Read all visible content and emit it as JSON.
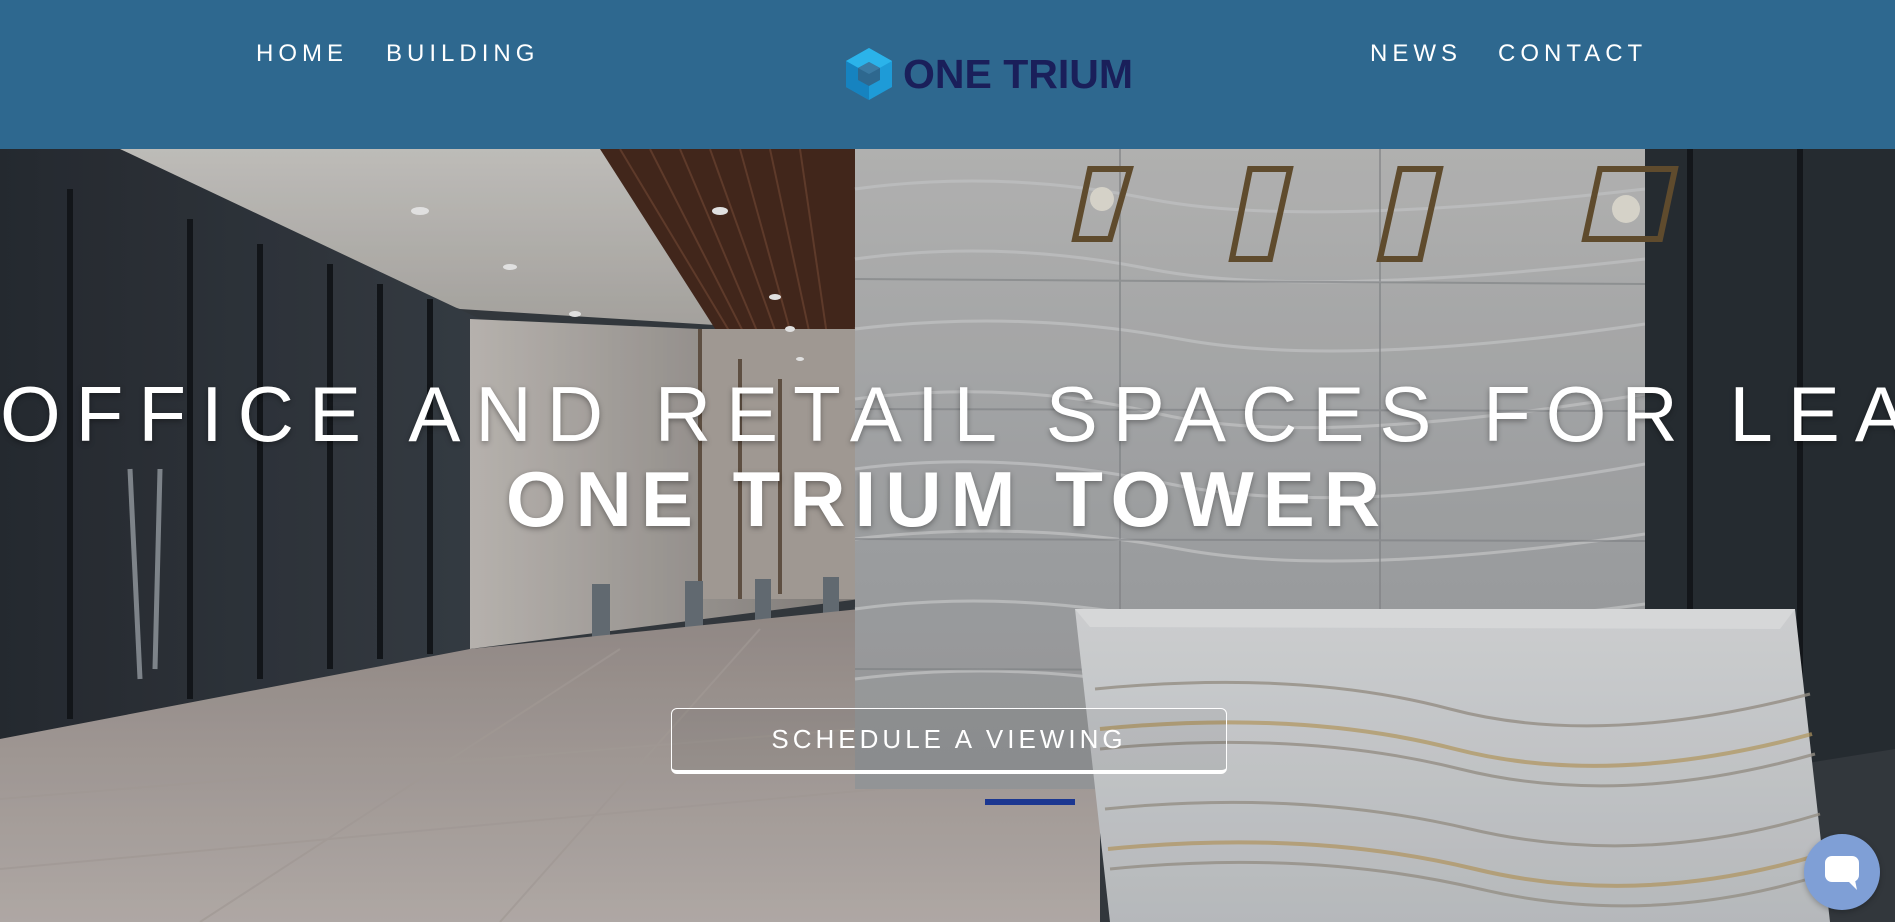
{
  "nav": {
    "left": [
      {
        "label": "HOME"
      },
      {
        "label": "BUILDING"
      }
    ],
    "right": [
      {
        "label": "NEWS"
      },
      {
        "label": "CONTACT"
      }
    ]
  },
  "logo": {
    "text": "ONE TRIUM",
    "icon": "cube-logo-icon",
    "color": "#1a1f5a",
    "mark_color": "#1e9bd7"
  },
  "hero": {
    "headline": "OFFICE AND RETAIL SPACES FOR LEASE",
    "title": "ONE TRIUM TOWER",
    "cta_label": "SCHEDULE A VIEWING"
  },
  "chat": {
    "icon": "chat-bubble-icon"
  },
  "colors": {
    "header_bg": "#2e688f",
    "text": "#ffffff",
    "chat_bg": "#7f9fd6"
  }
}
